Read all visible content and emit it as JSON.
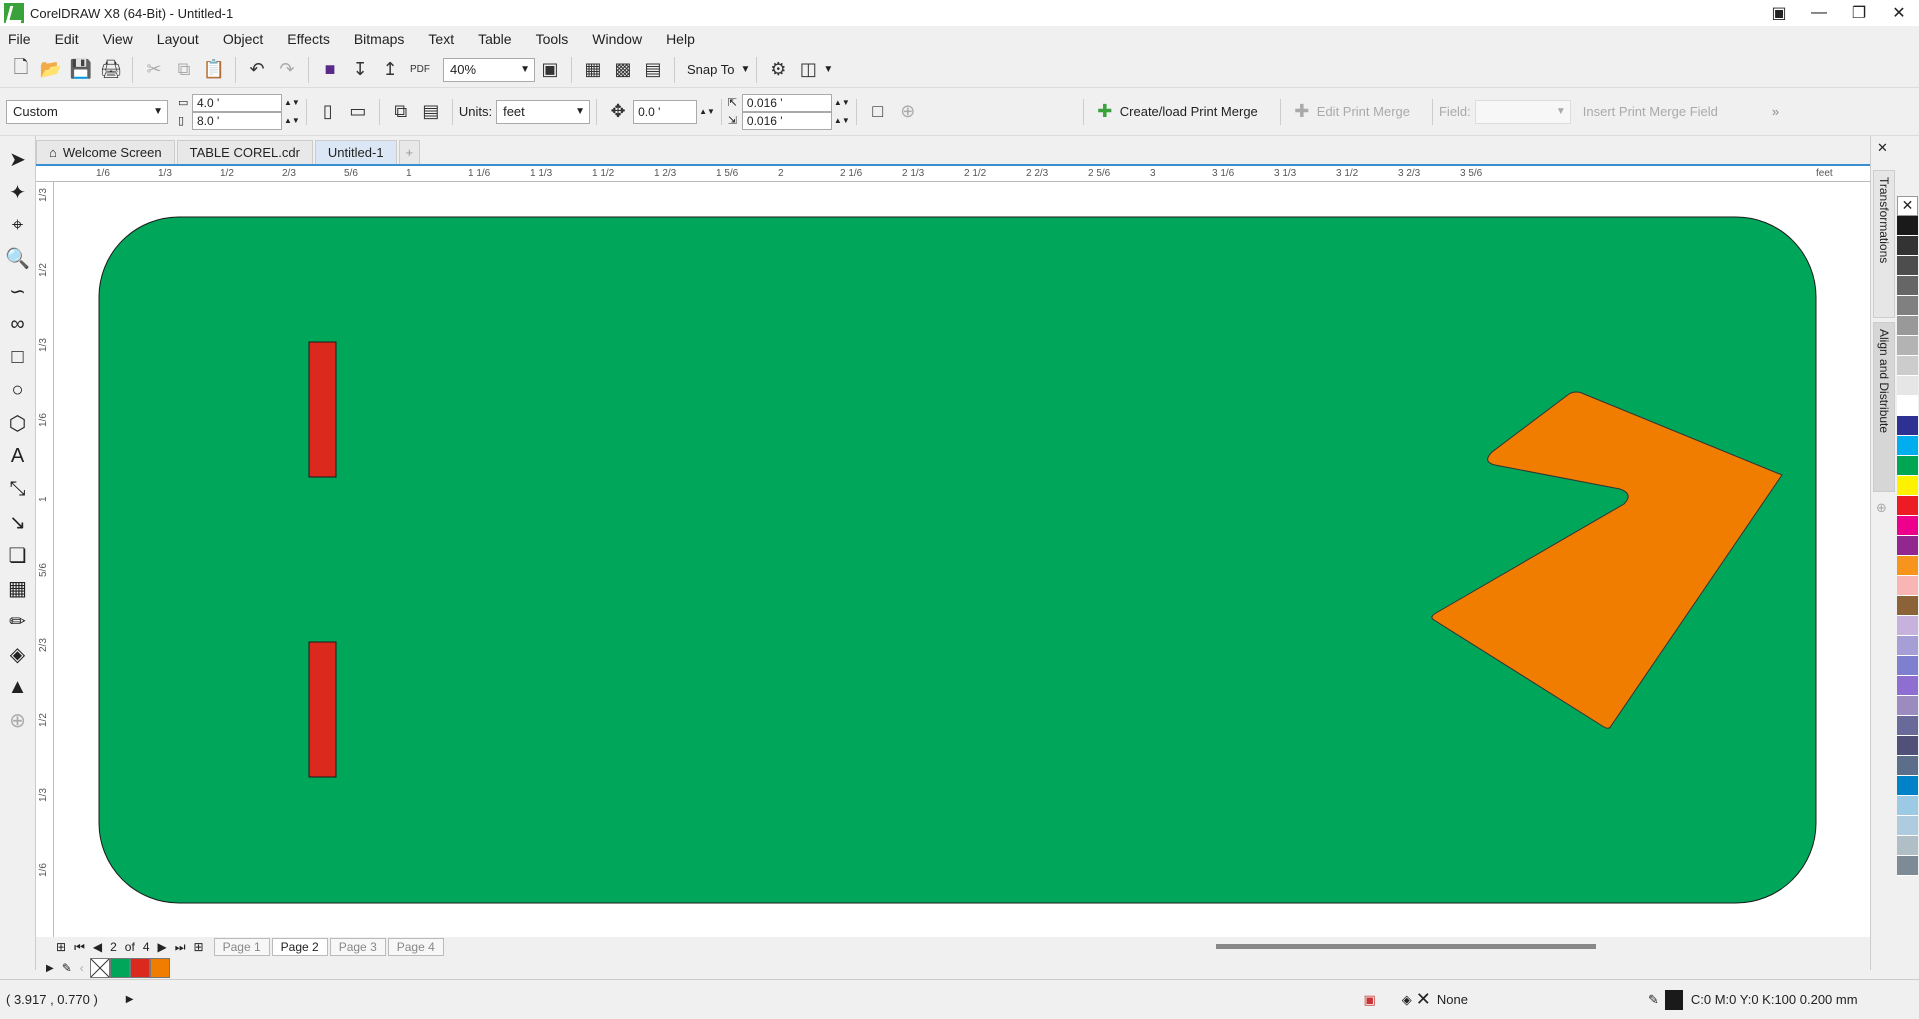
{
  "window": {
    "title": "CorelDRAW X8 (64-Bit) - Untitled-1",
    "controls": [
      "minimize-icon",
      "restore-icon",
      "close-icon"
    ]
  },
  "menu": [
    "File",
    "Edit",
    "View",
    "Layout",
    "Object",
    "Effects",
    "Bitmaps",
    "Text",
    "Table",
    "Tools",
    "Window",
    "Help"
  ],
  "toolbar": {
    "zoom": "40%",
    "snap_label": "Snap To",
    "pdf_label": "PDF"
  },
  "propertybar": {
    "page_size": "Custom",
    "width": "4.0 '",
    "height": "8.0 '",
    "units_label": "Units:",
    "units_value": "feet",
    "nudge": "0.0 '",
    "dup_x": "0.016 '",
    "dup_y": "0.016 '",
    "print_merge": "Create/load Print Merge",
    "edit_print_merge": "Edit Print Merge",
    "field_label": "Field:",
    "insert_field": "Insert Print Merge Field"
  },
  "tabs": [
    {
      "label": "Welcome Screen",
      "active": false
    },
    {
      "label": "TABLE COREL.cdr",
      "active": false
    },
    {
      "label": "Untitled-1",
      "active": true
    }
  ],
  "ruler": {
    "h_labels": [
      "1/6",
      "1/3",
      "1/2",
      "2/3",
      "5/6",
      "1",
      "1 1/6",
      "1 1/3",
      "1 1/2",
      "1 2/3",
      "1 5/6",
      "2",
      "2 1/6",
      "2 1/3",
      "2 1/2",
      "2 2/3",
      "2 5/6",
      "3",
      "3 1/6",
      "3 1/3",
      "3 1/2",
      "3 2/3",
      "3 5/6",
      "feet"
    ],
    "v_labels": [
      "1/3",
      "1/2",
      "1/3",
      "1/6",
      "1",
      "5/6",
      "2/3",
      "1/2",
      "1/3",
      "1/6"
    ]
  },
  "pages": {
    "current": "2",
    "of_label": "of",
    "total": "4",
    "tabs": [
      "Page 1",
      "Page 2",
      "Page 3",
      "Page 4"
    ],
    "active_index": 1
  },
  "doc_palette_colors": [
    "#00a65a",
    "#dc291e",
    "#f07d00"
  ],
  "drawing": {
    "table_color": "#00a65a",
    "rect_color": "#dc291e",
    "shape_color": "#f07d00"
  },
  "status": {
    "coords": "( 3.917 , 0.770  )",
    "fill_label": "None",
    "outline_label": "C:0 M:0 Y:0 K:100  0.200 mm"
  },
  "dockers": [
    "Transformations",
    "Align and Distribute"
  ],
  "palette": [
    "#1a1a1a",
    "#333333",
    "#4d4d4d",
    "#666666",
    "#808080",
    "#999999",
    "#b3b3b3",
    "#cccccc",
    "#e6e6e6",
    "#ffffff",
    "#2e3192",
    "#00aeef",
    "#00a651",
    "#fff200",
    "#ed1c24",
    "#ec008c",
    "#92278f",
    "#f7941d",
    "#f9b4b4",
    "#8c6239",
    "#c7b2de",
    "#a59fd6",
    "#7f7fcf",
    "#8f6ed1",
    "#9c8bbf",
    "#6a6a9a",
    "#505078",
    "#5d6e8a",
    "#0082c8",
    "#9cc9e3",
    "#aecbe0",
    "#b0bec5",
    "#7d8b96"
  ]
}
